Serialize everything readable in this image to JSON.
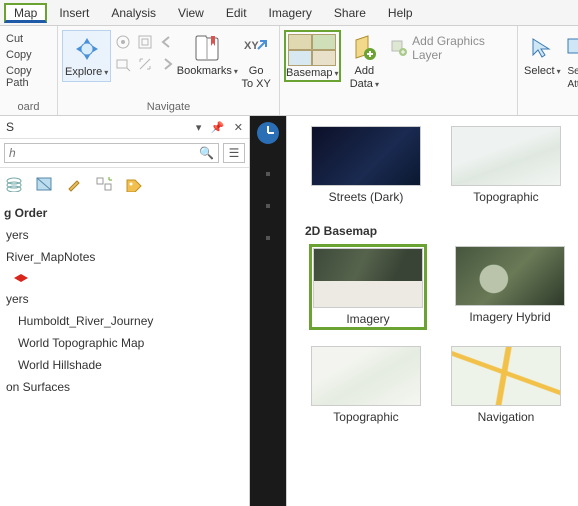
{
  "menubar": {
    "items": [
      "Map",
      "Insert",
      "Analysis",
      "View",
      "Edit",
      "Imagery",
      "Share",
      "Help"
    ],
    "active": "Map"
  },
  "ribbon": {
    "clipboard": {
      "items": [
        "Cut",
        "Copy",
        "Copy Path"
      ],
      "group_label": "oard"
    },
    "navigate": {
      "explore_label": "Explore",
      "bookmarks_label": "Bookmarks",
      "gotoxy_label_line1": "Go",
      "gotoxy_label_line2": "To XY",
      "group_label": "Navigate"
    },
    "layer": {
      "basemap_label": "Basemap",
      "add_data_label_line1": "Add",
      "add_data_label_line2": "Data",
      "add_graphics_label": "Add Graphics Layer"
    },
    "selection": {
      "select_label": "Select",
      "select_attr_label_line1": "Se",
      "select_attr_label_line2": "Att"
    }
  },
  "panel": {
    "title_suffix": "S",
    "search_placeholder": "h",
    "section_title": "g Order",
    "tree": {
      "item1": "yers",
      "item2": "River_MapNotes",
      "item3": "yers",
      "sub1": "Humboldt_River_Journey",
      "sub2": "World Topographic Map",
      "sub3": "World Hillshade",
      "item4": "on Surfaces"
    }
  },
  "basemap_panel": {
    "row1": [
      {
        "label": "Streets (Dark)"
      },
      {
        "label": "Topographic"
      }
    ],
    "section_title": "2D Basemap",
    "row2": [
      {
        "label": "Imagery",
        "active": true
      },
      {
        "label": "Imagery Hybrid"
      }
    ],
    "row3": [
      {
        "label": "Topographic"
      },
      {
        "label": "Navigation"
      }
    ]
  }
}
